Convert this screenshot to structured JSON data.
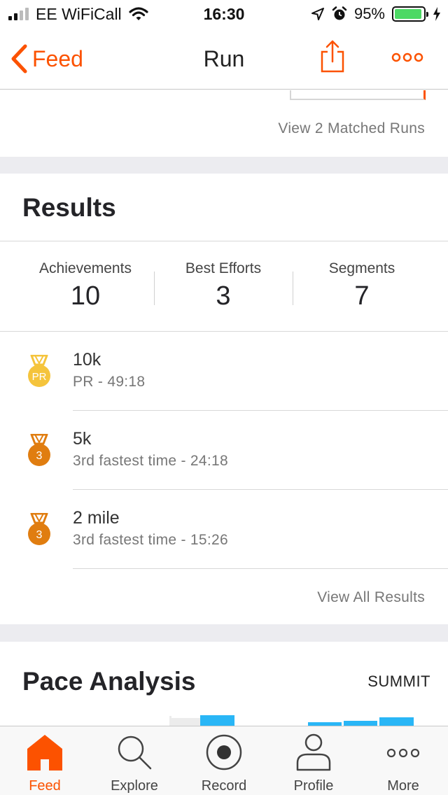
{
  "status_bar": {
    "carrier": "EE WiFiCall",
    "time": "16:30",
    "battery_percent": "95%",
    "battery_level": 0.95,
    "icons": [
      "signal-icon",
      "wifi-icon",
      "location-arrow-icon",
      "alarm-icon",
      "battery-icon",
      "charging-icon"
    ]
  },
  "nav": {
    "back_label": "Feed",
    "title": "Run",
    "icons": [
      "chevron-left-icon",
      "share-icon",
      "more-icon"
    ]
  },
  "matched": {
    "link": "View 2 Matched Runs"
  },
  "results": {
    "heading": "Results",
    "stats": [
      {
        "label": "Achievements",
        "value": "10"
      },
      {
        "label": "Best Efforts",
        "value": "3"
      },
      {
        "label": "Segments",
        "value": "7"
      }
    ],
    "items": [
      {
        "title": "10k",
        "subtitle": "PR - 49:18",
        "badge": "PR",
        "medal": "gold"
      },
      {
        "title": "5k",
        "subtitle": "3rd fastest time - 24:18",
        "badge": "3",
        "medal": "bronze"
      },
      {
        "title": "2 mile",
        "subtitle": "3rd fastest time - 15:26",
        "badge": "3",
        "medal": "bronze"
      }
    ],
    "view_all": "View All Results"
  },
  "pace": {
    "title": "Pace Analysis",
    "summit_label": "SUMMIT"
  },
  "tab_bar": {
    "tabs": [
      {
        "label": "Feed",
        "icon": "home-icon",
        "active": true
      },
      {
        "label": "Explore",
        "icon": "search-icon",
        "active": false
      },
      {
        "label": "Record",
        "icon": "record-icon",
        "active": false
      },
      {
        "label": "Profile",
        "icon": "profile-icon",
        "active": false
      },
      {
        "label": "More",
        "icon": "more-icon",
        "active": false
      }
    ]
  },
  "colors": {
    "accent": "#fc5200",
    "gold_medal": "#f5c43c",
    "bronze_medal": "#e07d10",
    "chart_bar": "#29b6f6",
    "section_gap": "#ececf0"
  }
}
